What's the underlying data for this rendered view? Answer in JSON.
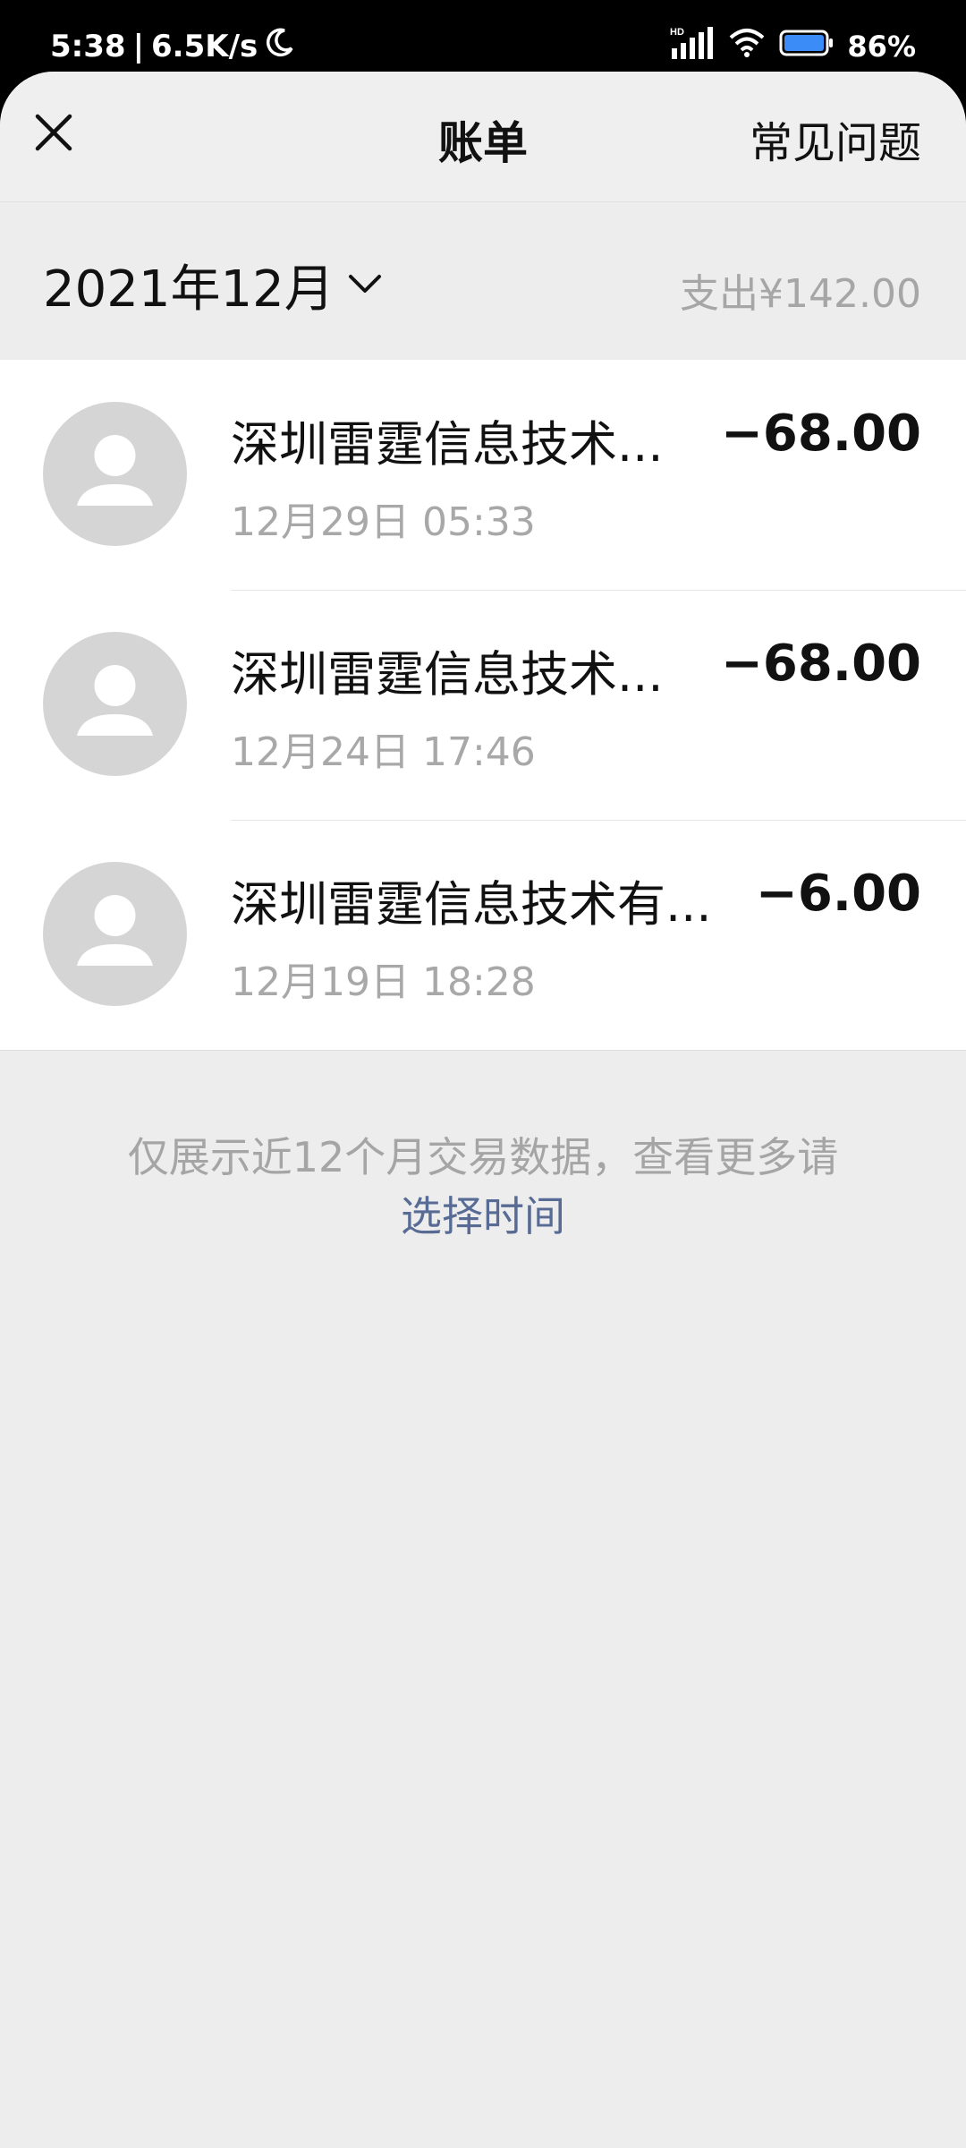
{
  "status_bar": {
    "time": "5:38",
    "speed": "6.5K/s",
    "hd": "HD",
    "battery": "86%"
  },
  "header": {
    "title": "账单",
    "faq": "常见问题"
  },
  "month_bar": {
    "month": "2021年12月",
    "spend": "支出¥142.00"
  },
  "transactions": [
    {
      "merchant": "深圳雷霆信息技术...",
      "time": "12月29日 05:33",
      "amount": "−68.00"
    },
    {
      "merchant": "深圳雷霆信息技术...",
      "time": "12月24日 17:46",
      "amount": "−68.00"
    },
    {
      "merchant": "深圳雷霆信息技术有...",
      "time": "12月19日 18:28",
      "amount": "−6.00"
    }
  ],
  "footer": {
    "note": "仅展示近12个月交易数据，查看更多请",
    "link": "选择时间"
  },
  "colors": {
    "accent_link": "#576b95",
    "avatar_bg": "#d5d5d5",
    "page_bg": "#ededed"
  },
  "icons": [
    "moon-icon",
    "signal-icon",
    "wifi-icon",
    "battery-icon",
    "close-icon",
    "chevron-down-icon",
    "person-icon"
  ]
}
